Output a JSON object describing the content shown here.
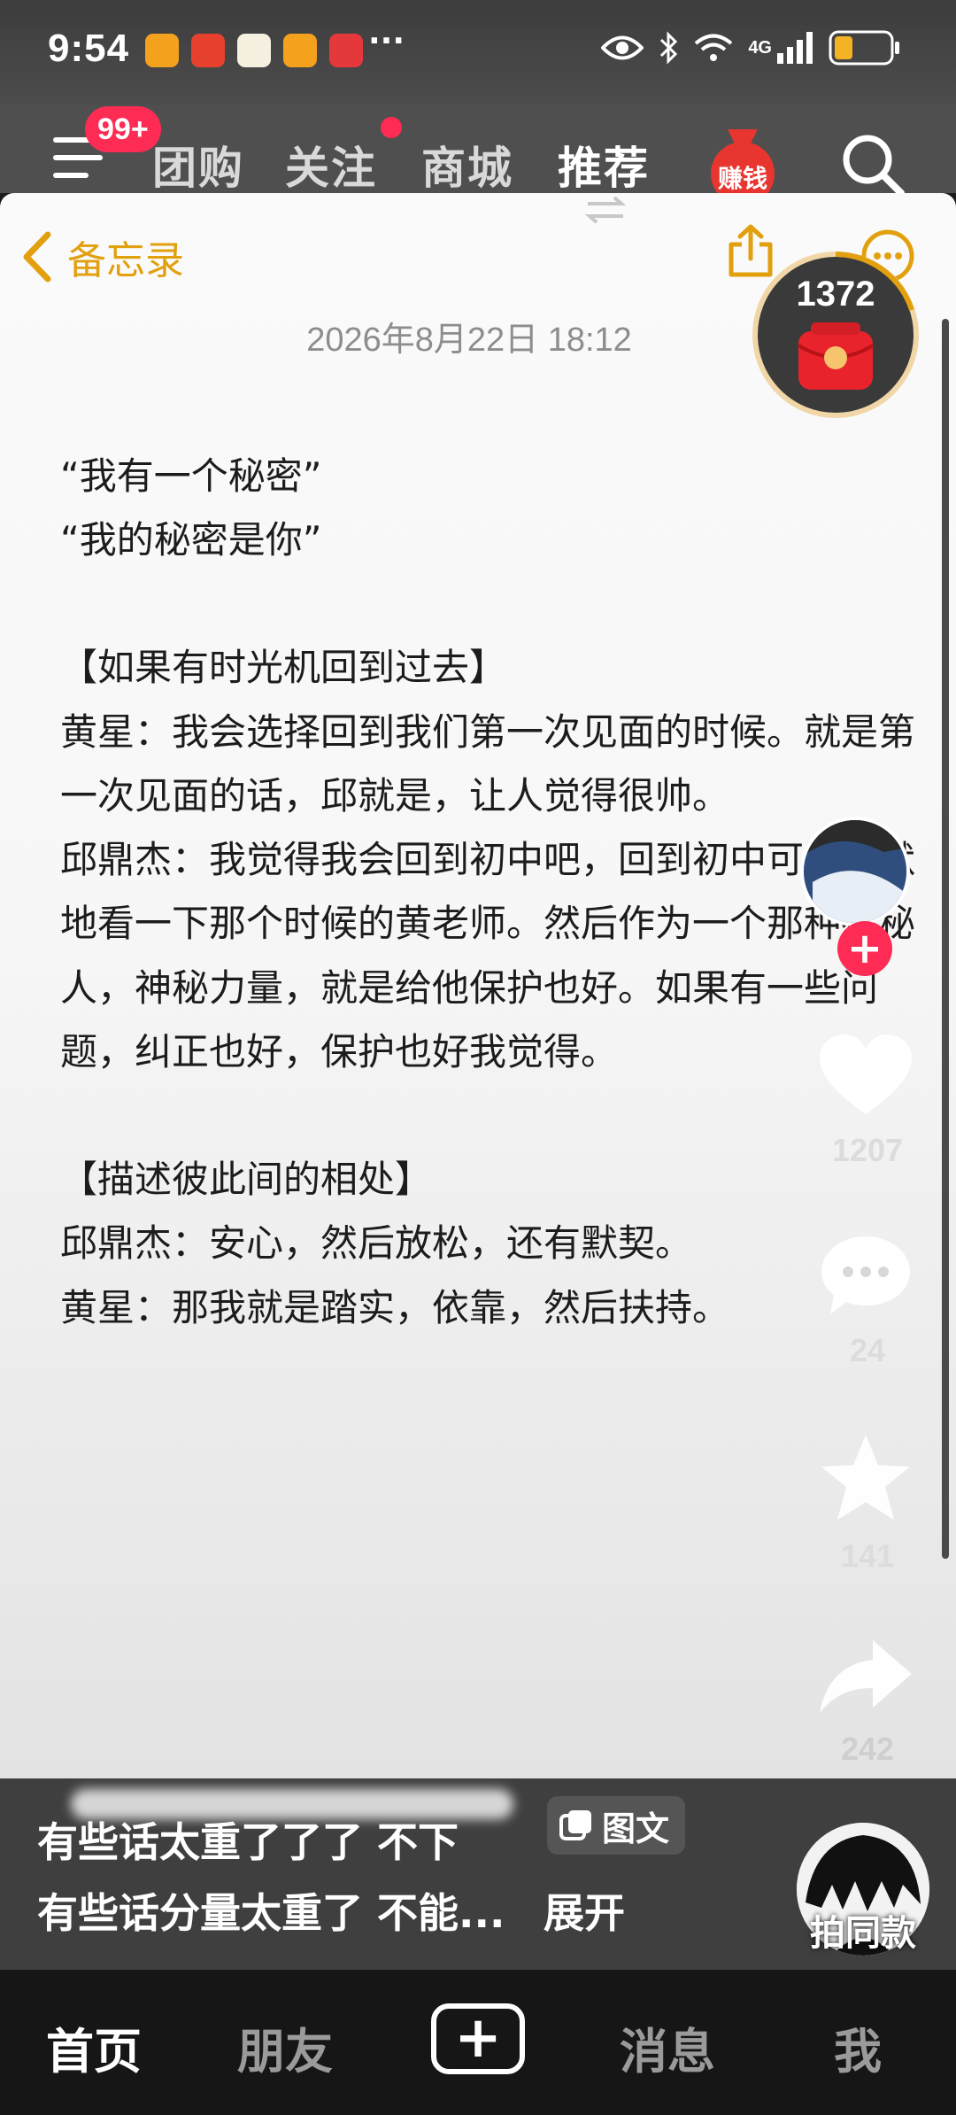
{
  "status_bar": {
    "time": "9:54",
    "more": "···",
    "network": "4G"
  },
  "top_nav": {
    "menu_badge": "99+",
    "tabs": [
      {
        "label": "团购"
      },
      {
        "label": "关注"
      },
      {
        "label": "商城"
      },
      {
        "label": "推荐"
      }
    ],
    "earn_label": "赚钱"
  },
  "note": {
    "back_label": "备忘录",
    "date": "2026年8月22日 18:12",
    "paragraphs": [
      "“我有一个秘密”",
      "“我的秘密是你”",
      "",
      "【如果有时光机回到过去】",
      "黄星：我会选择回到我们第一次见面的时候。就是第一次见面的话，邱就是，让人觉得很帅。",
      "邱鼎杰：我觉得我会回到初中吧，回到初中可以默默地看一下那个时候的黄老师。然后作为一个那种神秘人，神秘力量，就是给他保护也好。如果有一些问题，纠正也好，保护也好我觉得。",
      "",
      "【描述彼此间的相处】",
      "邱鼎杰：安心，然后放松，还有默契。",
      "黄星：那我就是踏实，依靠，然后扶持。"
    ]
  },
  "coin_widget": {
    "count": "1372"
  },
  "actions": {
    "likes": "1207",
    "comments": "24",
    "favorites": "141",
    "shares": "242"
  },
  "caption": {
    "line1": "有些话太重了了了 不下",
    "tag": "图文",
    "line2": "有些话分量太重了 不能...",
    "expand": "展开",
    "remix": "拍同款"
  },
  "bottom_nav": {
    "home": "首页",
    "friends": "朋友",
    "create": "+",
    "messages": "消息",
    "me": "我"
  },
  "colors": {
    "accent": "#fe2c55",
    "note_yellow": "#e2a00f"
  }
}
